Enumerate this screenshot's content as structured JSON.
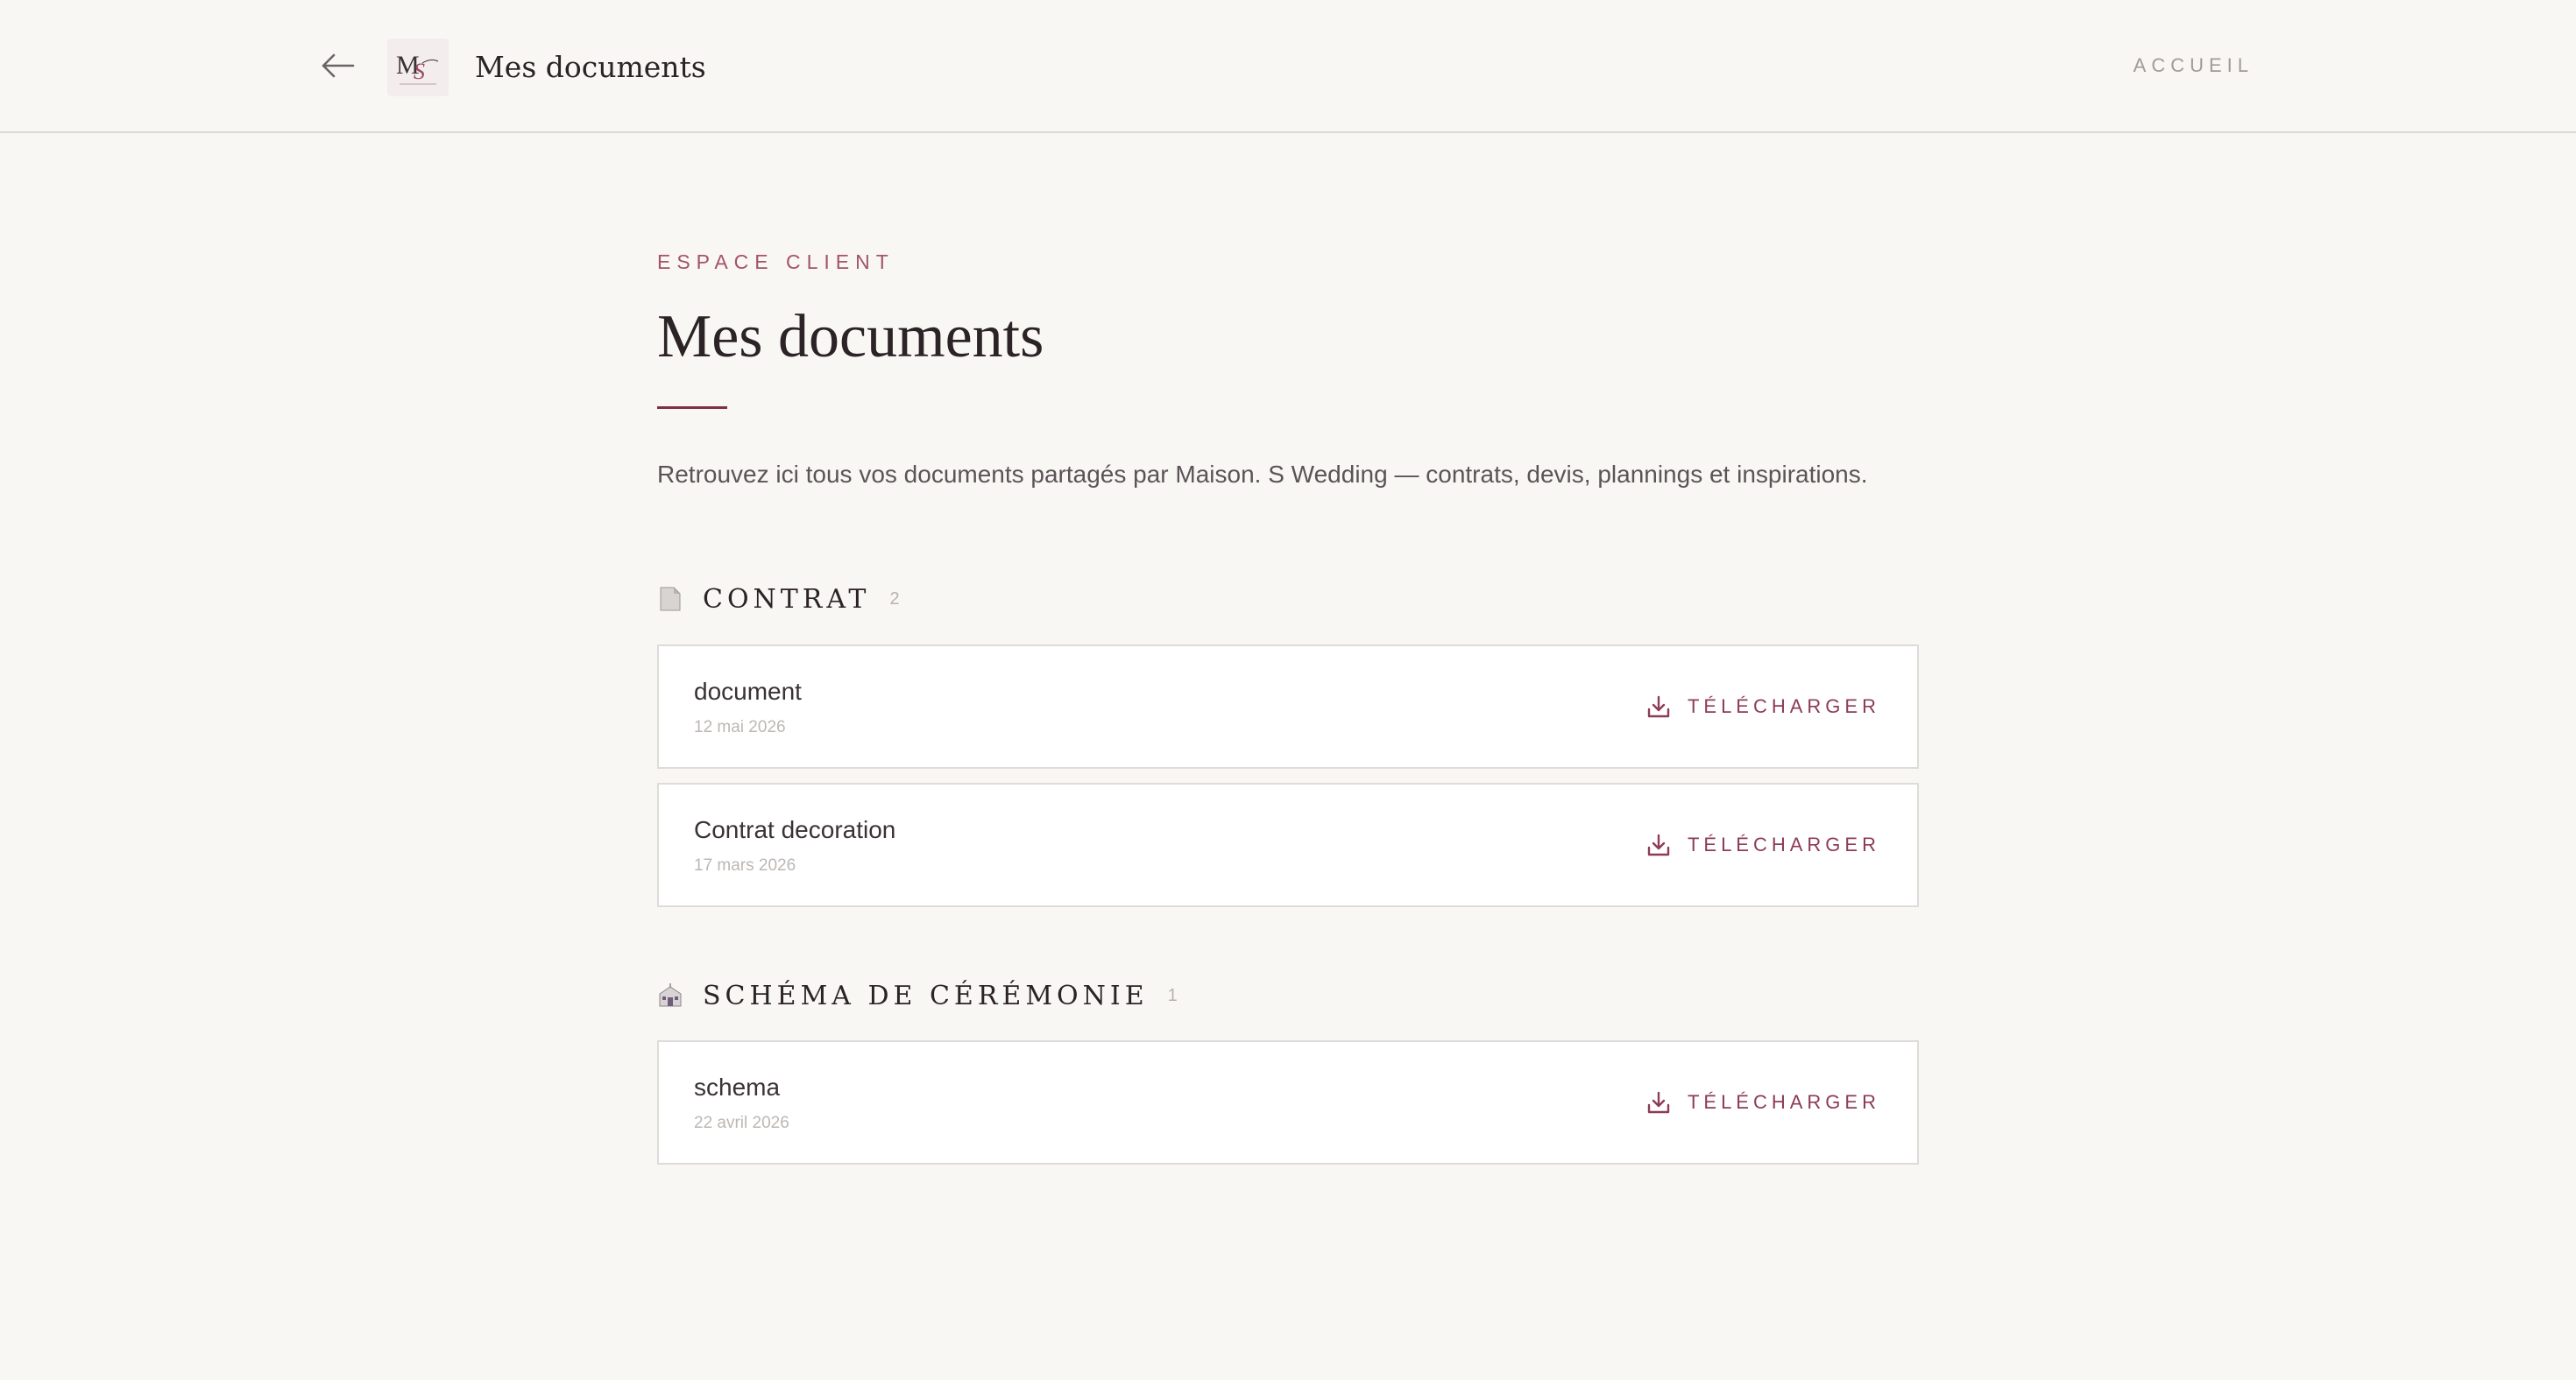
{
  "header": {
    "back_icon": "arrow-left-icon",
    "logo_text": "MS",
    "title": "Mes documents",
    "nav_home": "ACCUEIL"
  },
  "main": {
    "eyebrow": "ESPACE CLIENT",
    "title": "Mes documents",
    "intro": "Retrouvez ici tous vos documents partagés par Maison. S Wedding — contrats, devis, plannings et inspirations.",
    "download_label": "TÉLÉCHARGER",
    "download_icon": "download-icon"
  },
  "sections": [
    {
      "icon": "document-icon",
      "label": "CONTRAT",
      "count": "2",
      "documents": [
        {
          "name": "document",
          "date": "12 mai 2026"
        },
        {
          "name": "Contrat decoration",
          "date": "17 mars 2026"
        }
      ]
    },
    {
      "icon": "chapel-icon",
      "label": "SCHÉMA DE CÉRÉMONIE",
      "count": "1",
      "documents": [
        {
          "name": "schema",
          "date": "22 avril 2026"
        }
      ]
    }
  ],
  "colors": {
    "background": "#f9f7f4",
    "accent": "#8d3b58",
    "rule": "#7d2f46",
    "card_border": "#dedbd8"
  }
}
